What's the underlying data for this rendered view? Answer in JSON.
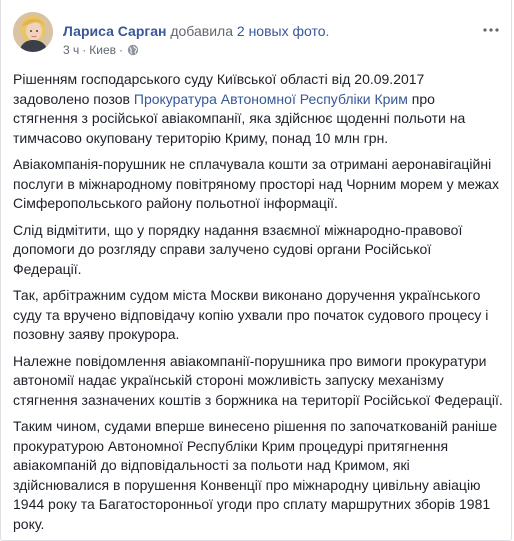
{
  "post": {
    "author_name": "Лариса Сарган",
    "action_text": "добавила",
    "action_link": "2 новых фото",
    "action_end": ".",
    "time": "3 ч",
    "location": "Киев",
    "meta_separator": "·",
    "paragraphs": {
      "p1_before": "Рішенням господарського суду Київської області від 20.09.2017 задоволено позов ",
      "p1_link": "Прокуратура Автономної Республіки Крим",
      "p1_after": " про стягнення з російської авіакомпанії, яка здійснює щоденні польоти на тимчасово окуповану територію Криму, понад 10 млн грн.",
      "p2": "Авіакомпанія-порушник не сплачувала кошти за отримані аеронавігаційні послуги в міжнародному повітряному просторі над Чорним морем у межах Сімферопольського району польотної інформації.",
      "p3": "Слід відмітити, що у порядку надання взаємної міжнародно-правової допомоги до розгляду справи залучено судові органи Російської Федерації.",
      "p4": "Так, арбітражним судом міста Москви виконано доручення українського суду та вручено відповідачу копію ухвали про початок судового процесу і позовну заяву прокурора.",
      "p5": "Належне повідомлення авіакомпанії-порушника про вимоги прокуратури автономії надає українській стороні можливість запуску механізму стягнення зазначених коштів з боржника на території Російської Федерації.",
      "p6": "Таким чином, судами вперше винесено рішення по започаткованій раніше прокуратурою Автономної Республіки Крим процедурі притягнення авіакомпаній до відповідальності за польоти над Кримом, які здійснювалися в порушення Конвенції про міжнародну цивільну авіацію 1944 року та Багатосторонньої угоди про сплату маршрутних зборів 1981 року."
    }
  },
  "colors": {
    "link": "#385898",
    "text": "#1d2129",
    "meta": "#606770"
  },
  "icons": {
    "avatar": "avatar",
    "globe": "globe-icon",
    "more": "more-options-icon"
  }
}
